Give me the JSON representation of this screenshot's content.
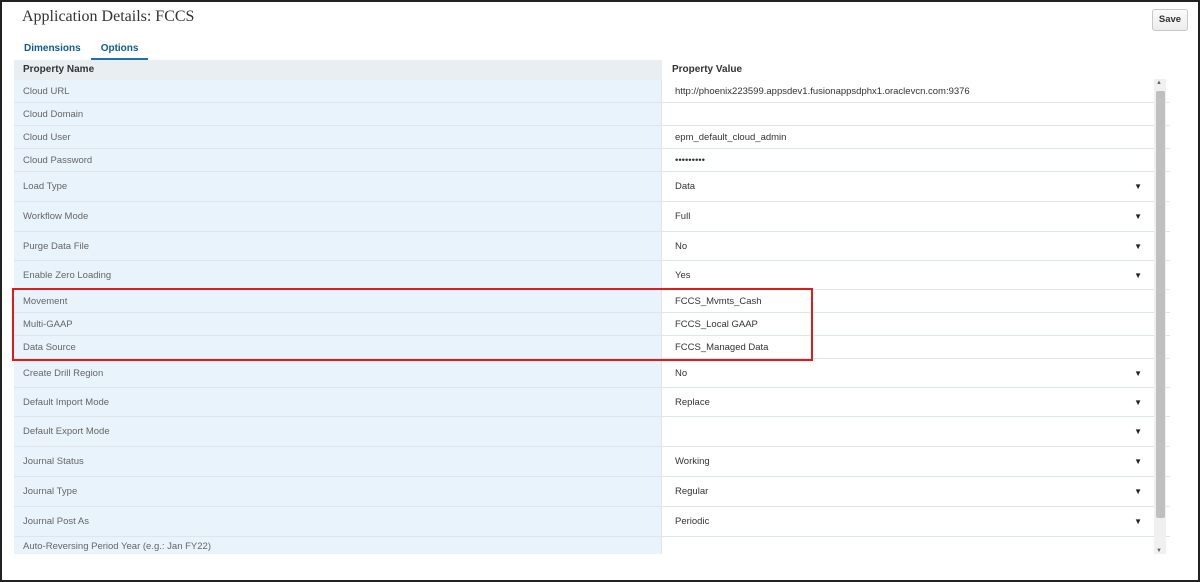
{
  "header": {
    "title": "Application Details: FCCS",
    "save_label": "Save"
  },
  "tabs": [
    {
      "label": "Dimensions"
    },
    {
      "label": "Options"
    }
  ],
  "columns": {
    "name": "Property Name",
    "value": "Property Value"
  },
  "rows": [
    {
      "name": "Cloud URL",
      "value": "http://phoenix223599.appsdev1.fusionappsdphx1.oraclevcn.com:9376",
      "dropdown": false
    },
    {
      "name": "Cloud Domain",
      "value": "",
      "dropdown": false
    },
    {
      "name": "Cloud User",
      "value": "epm_default_cloud_admin",
      "dropdown": false
    },
    {
      "name": "Cloud Password",
      "value": "•••••••••",
      "dropdown": false
    },
    {
      "name": "Load Type",
      "value": "Data",
      "dropdown": true
    },
    {
      "name": "Workflow Mode",
      "value": "Full",
      "dropdown": true
    },
    {
      "name": "Purge Data File",
      "value": "No",
      "dropdown": true
    },
    {
      "name": "Enable Zero Loading",
      "value": "Yes",
      "dropdown": true
    },
    {
      "name": "Movement",
      "value": "FCCS_Mvmts_Cash",
      "dropdown": false
    },
    {
      "name": "Multi-GAAP",
      "value": "FCCS_Local GAAP",
      "dropdown": false
    },
    {
      "name": "Data Source",
      "value": "FCCS_Managed Data",
      "dropdown": false
    },
    {
      "name": "Create Drill Region",
      "value": "No",
      "dropdown": true
    },
    {
      "name": "Default Import Mode",
      "value": "Replace",
      "dropdown": true
    },
    {
      "name": "Default Export Mode",
      "value": "",
      "dropdown": true
    },
    {
      "name": "Journal Status",
      "value": "Working",
      "dropdown": true
    },
    {
      "name": "Journal Type",
      "value": "Regular",
      "dropdown": true
    },
    {
      "name": "Journal Post As",
      "value": "Periodic",
      "dropdown": true
    },
    {
      "name": "Auto-Reversing Period Year (e.g.: Jan FY22)",
      "value": "",
      "dropdown": false
    }
  ],
  "icons": {
    "dropdown": "caret-down-icon",
    "scroll_up": "scroll-up-arrow-icon",
    "scroll_down": "scroll-down-arrow-icon"
  },
  "colors": {
    "highlight": "#e01b1b",
    "tab_accent": "#1a73ad",
    "name_column_bg": "#e9f3fb"
  }
}
